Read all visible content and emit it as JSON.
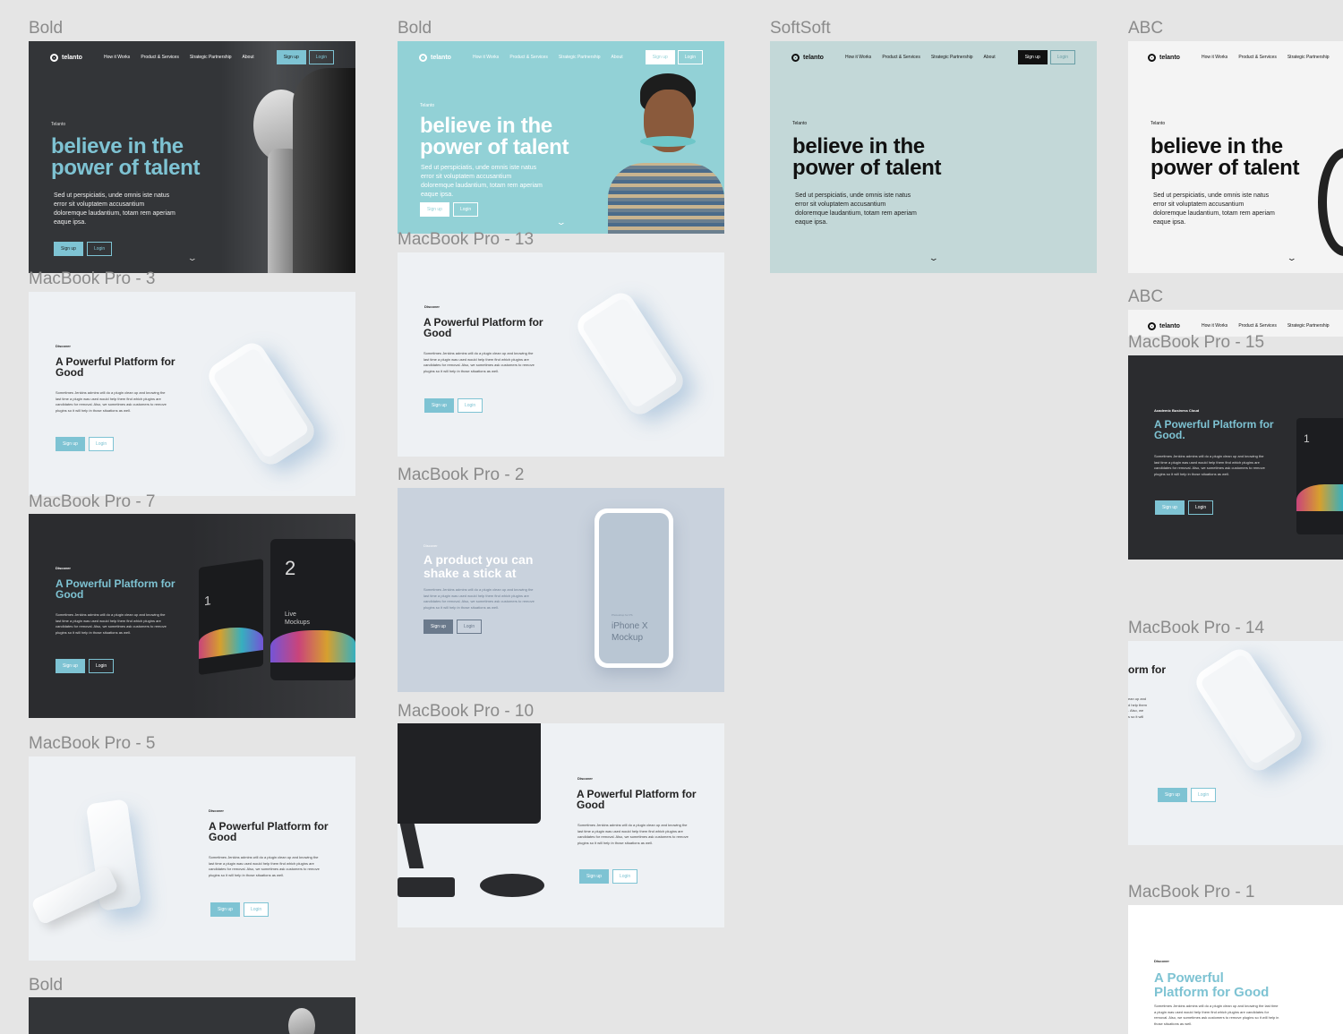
{
  "frame_labels": {
    "bold_1": "Bold",
    "bold_2": "Bold",
    "softsoft": "SoftSoft",
    "abc_1": "ABC",
    "abc_2": "ABC",
    "mbp3": "MacBook Pro - 3",
    "mbp7": "MacBook Pro - 7",
    "mbp5": "MacBook Pro - 5",
    "bold_3": "Bold",
    "mbp13": "MacBook Pro - 13",
    "mbp2": "MacBook Pro - 2",
    "mbp10": "MacBook Pro - 10",
    "mbp15": "MacBook Pro - 15",
    "mbp14": "MacBook Pro - 14",
    "mbp1": "MacBook Pro - 1"
  },
  "nav": {
    "brand": "telanto",
    "links": [
      "How it Works",
      "Product & Services",
      "Strategic Partnership",
      "About"
    ],
    "signup": "Sign up",
    "login": "Login"
  },
  "hero": {
    "eyebrow": "Telanto",
    "title": "believe in the\npower of talent",
    "body": "Sed ut perspiciatis, unde omnis iste natus error sit voluptatem accusantium doloremque laudantium, totam rem aperiam eaque ipsa."
  },
  "platform": {
    "eyebrow": "Discover",
    "eyebrow_academic": "Academic Business Cloud",
    "title": "A Powerful Platform for\nGood",
    "title_dot": "A Powerful Platform for\nGood.",
    "title_narrow": "A Powerful\nPlatform for Good",
    "title_cut": "orm for",
    "body": "Sometimes Jenkins admins will do a plugin clean up and knowing the last time a plugin was used would help them find which plugins are candidates for removal. Also, we sometimes ask customers to remove plugins so it will help in those situations as well.",
    "body_cut": "ean up and\nd help them\n. Also, we\ns so it will"
  },
  "product": {
    "eyebrow": "Discover",
    "title": "A product you can\nshake a stick at",
    "phone_caption": "Photoshop for PS",
    "phone_title": "iPhone X\nMockup"
  },
  "mockup": {
    "number_1": "1",
    "number_2": "2",
    "live": "Live\nMockups"
  },
  "colors": {
    "accent": "#7ec3d3",
    "dark": "#2e3033",
    "teal_bg": "#92d1d6",
    "soft_bg": "#c3d8d8",
    "light_bg": "#eef1f4",
    "canvas": "#e5e5e5"
  }
}
